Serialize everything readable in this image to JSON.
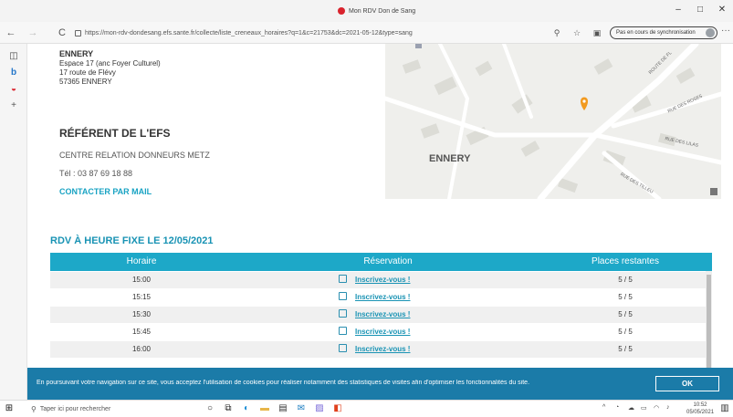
{
  "browser": {
    "tab_title": "Mon RDV Don de Sang",
    "url": "https://mon-rdv-dondesang.efs.sante.fr/collecte/liste_creneaux_horaires?q=1&c=21753&dc=2021-05-12&type=sang",
    "sync_label": "Pas en cours de synchronisation",
    "controls": {
      "minimize": "–",
      "maximize": "□",
      "close": "✕",
      "back": "←",
      "forward": "→",
      "reload": "C",
      "more": "···"
    }
  },
  "site": {
    "name": "ENNERY",
    "address": [
      "Espace 17 (anc Foyer Culturel)",
      "17 route de Flévy",
      "57365 ENNERY"
    ]
  },
  "referent": {
    "title": "RÉFÉRENT DE L'EFS",
    "center": "CENTRE RELATION DONNEURS METZ",
    "phone": "Tél : 03 87 69 18 88",
    "contact_link": "CONTACTER PAR MAIL"
  },
  "map": {
    "town_label": "ENNERY",
    "street_labels": [
      "ROUTE DE FL",
      "RUE DES ROSES",
      "RUE DES LILAS",
      "RUE DES TILLEU"
    ],
    "marker_color": "#f29a1f"
  },
  "rdv": {
    "title": "RDV À HEURE FIXE LE 12/05/2021",
    "headers": [
      "Horaire",
      "Réservation",
      "Places restantes"
    ],
    "rows": [
      {
        "time": "15:00",
        "action": "Inscrivez-vous !",
        "places": "5 / 5"
      },
      {
        "time": "15:15",
        "action": "Inscrivez-vous !",
        "places": "5 / 5"
      },
      {
        "time": "15:30",
        "action": "Inscrivez-vous !",
        "places": "5 / 5"
      },
      {
        "time": "15:45",
        "action": "Inscrivez-vous !",
        "places": "5 / 5"
      },
      {
        "time": "16:00",
        "action": "Inscrivez-vous !",
        "places": "5 / 5"
      }
    ]
  },
  "cookie_banner": {
    "message": "En poursuivant votre navigation sur ce site, vous acceptez l'utilisation de cookies pour réaliser notamment des statistiques de visites afin d'optimiser les fonctionnalités du site.",
    "ok_label": "OK"
  },
  "taskbar": {
    "search_placeholder": "Taper ici pour rechercher",
    "clock_time": "10:52",
    "clock_date": "05/05/2021"
  },
  "colors": {
    "accent": "#1da8c8",
    "link": "#1993b4",
    "cookie_bg": "#1b7ba8"
  }
}
